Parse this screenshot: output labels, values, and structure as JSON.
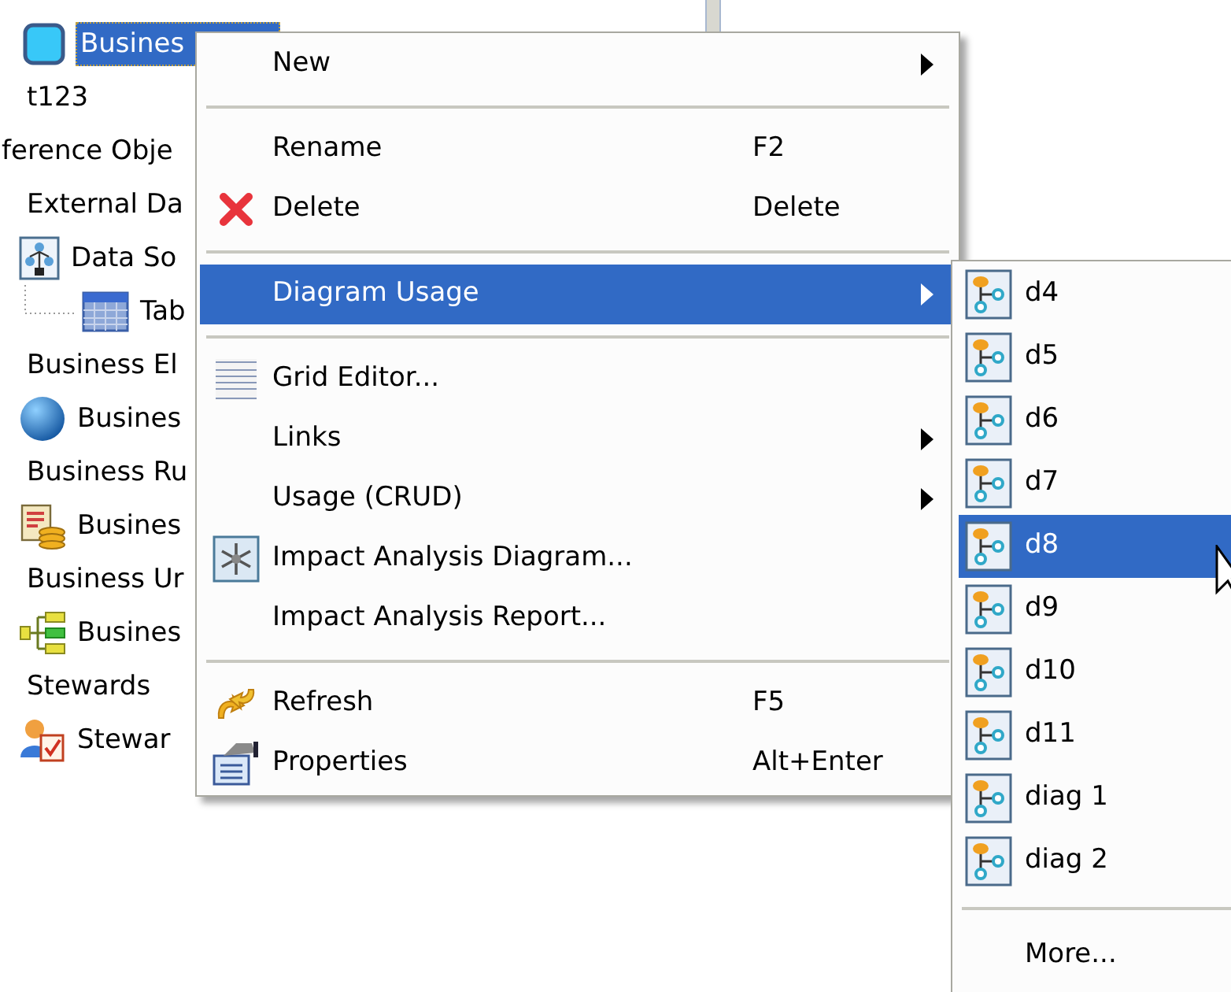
{
  "tree": [
    {
      "label": "Busines",
      "selected": true
    },
    {
      "label": "t123",
      "selected": false
    },
    {
      "label": "ference Obje",
      "selected": false
    },
    {
      "label": "External Da",
      "selected": false,
      "children": [
        {
          "label": "Data So",
          "selected": false,
          "children": [
            {
              "label": "Tab",
              "selected": false
            }
          ]
        }
      ]
    },
    {
      "label": "Business El",
      "selected": false,
      "children": [
        {
          "label": "Busines",
          "selected": false
        }
      ]
    },
    {
      "label": "Business Ru",
      "selected": false,
      "children": [
        {
          "label": "Busines",
          "selected": false
        }
      ]
    },
    {
      "label": "Business Ur",
      "selected": false,
      "children": [
        {
          "label": "Busines",
          "selected": false
        }
      ]
    },
    {
      "label": "Stewards",
      "selected": false,
      "children": [
        {
          "label": "Stewar",
          "selected": false
        }
      ]
    }
  ],
  "context_menu": [
    {
      "kind": "item",
      "label": "New",
      "submenu": true,
      "selected": false
    },
    {
      "kind": "separator"
    },
    {
      "kind": "item",
      "label": "Rename",
      "shortcut": "F2",
      "submenu": false,
      "selected": false
    },
    {
      "kind": "item",
      "label": "Delete",
      "shortcut": "Delete",
      "submenu": false,
      "selected": false
    },
    {
      "kind": "separator"
    },
    {
      "kind": "item",
      "label": "Diagram Usage",
      "submenu": true,
      "selected": true
    },
    {
      "kind": "separator"
    },
    {
      "kind": "item",
      "label": "Grid Editor...",
      "submenu": false,
      "selected": false
    },
    {
      "kind": "item",
      "label": "Links",
      "submenu": true,
      "selected": false
    },
    {
      "kind": "item",
      "label": "Usage (CRUD)",
      "submenu": true,
      "selected": false
    },
    {
      "kind": "item",
      "label": "Impact Analysis Diagram...",
      "submenu": false,
      "selected": false
    },
    {
      "kind": "item",
      "label": "Impact Analysis Report...",
      "submenu": false,
      "selected": false
    },
    {
      "kind": "separator"
    },
    {
      "kind": "item",
      "label": "Refresh",
      "shortcut": "F5",
      "submenu": false,
      "selected": false
    },
    {
      "kind": "item",
      "label": "Properties",
      "shortcut": "Alt+Enter",
      "submenu": false,
      "selected": false
    }
  ],
  "submenu": [
    {
      "kind": "diagram",
      "label": "d4",
      "selected": false
    },
    {
      "kind": "diagram",
      "label": "d5",
      "selected": false
    },
    {
      "kind": "diagram",
      "label": "d6",
      "selected": false
    },
    {
      "kind": "diagram",
      "label": "d7",
      "selected": false
    },
    {
      "kind": "diagram",
      "label": "d8",
      "selected": true
    },
    {
      "kind": "diagram",
      "label": "d9",
      "selected": false
    },
    {
      "kind": "diagram",
      "label": "d10",
      "selected": false
    },
    {
      "kind": "diagram",
      "label": "d11",
      "selected": false
    },
    {
      "kind": "diagram",
      "label": "diag 1",
      "selected": false
    },
    {
      "kind": "diagram",
      "label": "diag 2",
      "selected": false
    },
    {
      "kind": "separator"
    },
    {
      "kind": "more",
      "label": "More...",
      "selected": false
    }
  ]
}
